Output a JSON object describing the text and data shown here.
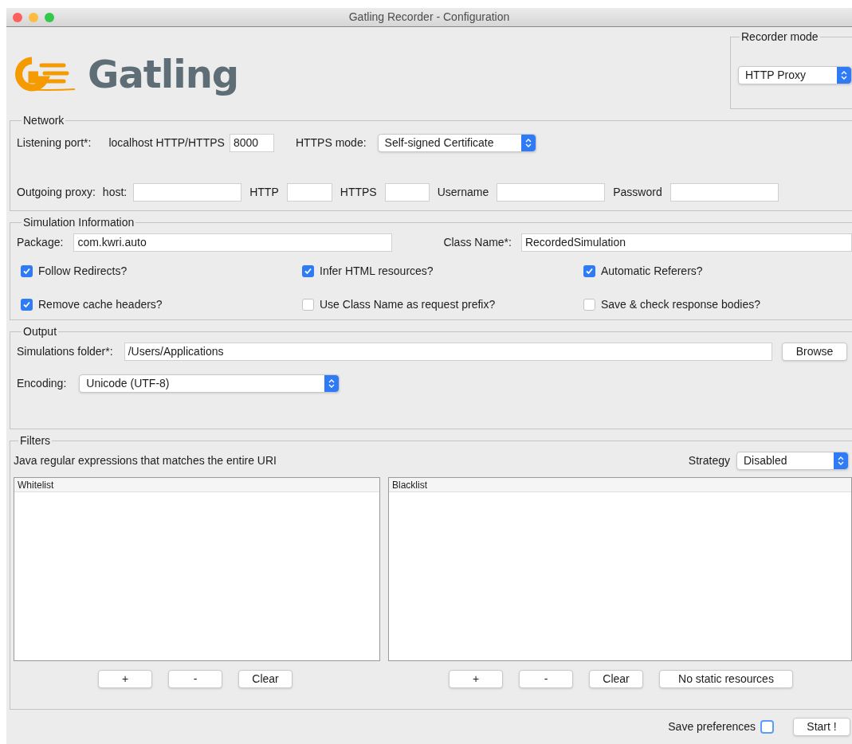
{
  "window": {
    "title": "Gatling Recorder - Configuration"
  },
  "logo": {
    "text": "Gatling"
  },
  "recorder_mode": {
    "title": "Recorder mode",
    "value": "HTTP Proxy"
  },
  "network": {
    "title": "Network",
    "listening_port_label": "Listening port*:",
    "localhost_label": "localhost HTTP/HTTPS",
    "port": "8000",
    "https_mode_label": "HTTPS mode:",
    "https_mode": "Self-signed Certificate",
    "outgoing_proxy_label": "Outgoing proxy:",
    "proxy_fields": [
      {
        "label": "host:"
      },
      {
        "label": "HTTP"
      },
      {
        "label": "HTTPS"
      },
      {
        "label": "Username"
      },
      {
        "label": "Password"
      }
    ]
  },
  "simulation": {
    "title": "Simulation Information",
    "package_label": "Package:",
    "package": "com.kwri.auto",
    "class_name_label": "Class Name*:",
    "class_name": "RecordedSimulation",
    "options": [
      {
        "label": "Follow Redirects?",
        "checked": true
      },
      {
        "label": "Infer HTML resources?",
        "checked": true
      },
      {
        "label": "Automatic Referers?",
        "checked": true
      },
      {
        "label": "Remove cache headers?",
        "checked": true
      },
      {
        "label": "Use Class Name as request prefix?",
        "checked": false
      },
      {
        "label": "Save & check response bodies?",
        "checked": false
      }
    ]
  },
  "output": {
    "title": "Output",
    "folder_label": "Simulations folder*:",
    "folder": "/Users/Applications",
    "browse": "Browse",
    "encoding_label": "Encoding:",
    "encoding": "Unicode (UTF-8)"
  },
  "filters": {
    "title": "Filters",
    "description": "Java regular expressions that matches the entire URI",
    "strategy_label": "Strategy",
    "strategy": "Disabled",
    "lists": [
      {
        "header": "Whitelist",
        "buttons": [
          "+",
          "-",
          "Clear"
        ]
      },
      {
        "header": "Blacklist",
        "buttons": [
          "+",
          "-",
          "Clear",
          "No static resources"
        ]
      }
    ]
  },
  "footer": {
    "save_preferences_label": "Save preferences",
    "save_preferences": false,
    "start": "Start !"
  }
}
